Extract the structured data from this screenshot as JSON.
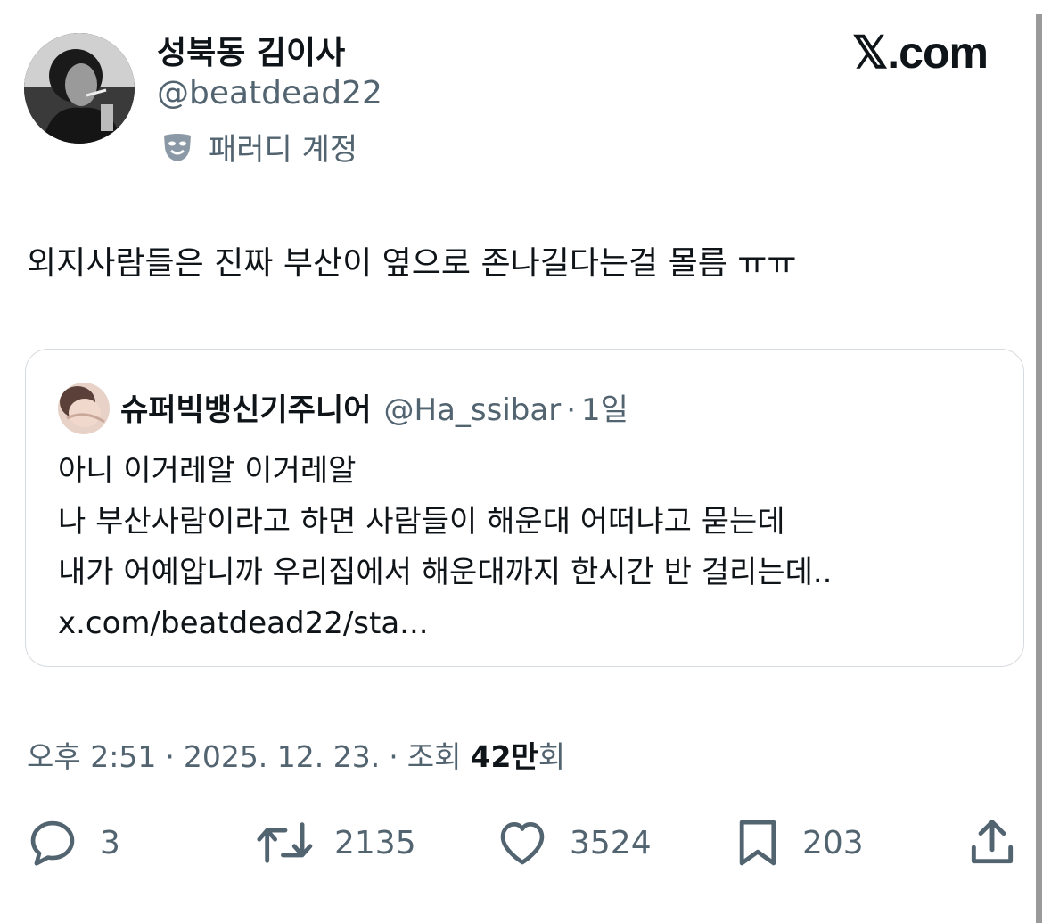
{
  "author": {
    "display_name": "성북동 김이사",
    "handle": "@beatdead22",
    "parody_label": "패러디 계정"
  },
  "brand": {
    "logo_text": "𝕏.com"
  },
  "tweet": {
    "text": "외지사람들은 진짜 부산이 옆으로 존나길다는걸 몰름 ㅠㅠ"
  },
  "quote": {
    "display_name": "슈퍼빅뱅신기주니어",
    "handle": "@Ha_ssibar",
    "separator": "·",
    "time": "1일",
    "lines": [
      "아니 이거레알 이거레알",
      "나 부산사람이라고 하면 사람들이 해운대 어떠냐고 묻는데",
      "내가 어예압니까 우리집에서 해운대까지 한시간 반 걸리는데..",
      "x.com/beatdead22/sta..."
    ]
  },
  "meta": {
    "time": "오후 2:51",
    "sep1": "·",
    "date": "2025. 12. 23.",
    "sep2": "·",
    "views_label": "조회",
    "views_count": "42만",
    "views_suffix": "회"
  },
  "actions": {
    "reply": {
      "icon": "reply-icon",
      "count": "3"
    },
    "repost": {
      "icon": "repost-icon",
      "count": "2135"
    },
    "like": {
      "icon": "heart-icon",
      "count": "3524"
    },
    "bookmark": {
      "icon": "bookmark-icon",
      "count": "203"
    },
    "share": {
      "icon": "share-icon"
    }
  },
  "colors": {
    "text": "#0f1419",
    "secondary": "#536471",
    "border": "#d6dbe0",
    "background": "#ffffff"
  }
}
